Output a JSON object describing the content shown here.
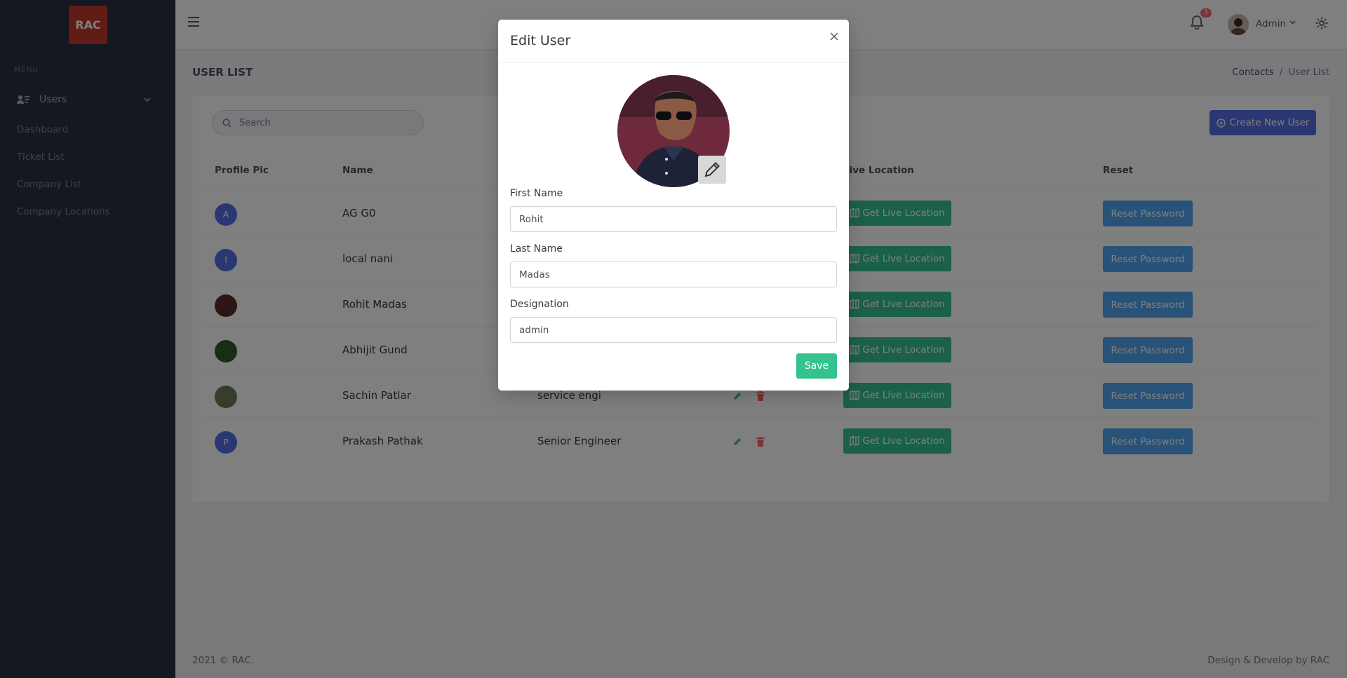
{
  "sidebar": {
    "logo": "RAC",
    "menu_title": "MENU",
    "users_label": "Users",
    "items": [
      {
        "label": "Dashboard"
      },
      {
        "label": "Ticket List"
      },
      {
        "label": "Company List"
      },
      {
        "label": "Company Locations"
      }
    ]
  },
  "header": {
    "notification_count": "3",
    "user_name": "Admin"
  },
  "page": {
    "title": "USER LIST",
    "breadcrumb": [
      "Contacts",
      "User List"
    ]
  },
  "toolbar": {
    "search_placeholder": "Search",
    "create_label": "Create New User"
  },
  "table": {
    "headers": {
      "profile": "Profile Pic",
      "name": "Name",
      "location": "Live Location",
      "reset": "Reset"
    },
    "location_label": "Get Live Location",
    "reset_label": "Reset Password",
    "rows": [
      {
        "initial": "A",
        "name": "AG G0",
        "designation": "",
        "avatar_color": "#556ee6"
      },
      {
        "initial": "l",
        "name": "local nani",
        "designation": "",
        "avatar_color": "#556ee6"
      },
      {
        "initial": "",
        "name": "Rohit Madas",
        "designation": "",
        "avatar_color": "#5a2a2a"
      },
      {
        "initial": "",
        "name": "Abhijit Gund",
        "designation": "",
        "avatar_color": "#2e5b2c"
      },
      {
        "initial": "",
        "name": "Sachin Patlar",
        "designation": "service engi",
        "avatar_color": "#6b7d55"
      },
      {
        "initial": "P",
        "name": "Prakash Pathak",
        "designation": "Senior Engineer",
        "avatar_color": "#556ee6"
      }
    ]
  },
  "footer": {
    "left": "2021 © RAC.",
    "right": "Design & Develop by RAC"
  },
  "modal": {
    "title": "Edit User",
    "first_name_label": "First Name",
    "first_name_value": "Rohit",
    "last_name_label": "Last Name",
    "last_name_value": "Madas",
    "designation_label": "Designation",
    "designation_value": "admin",
    "save_label": "Save"
  },
  "colors": {
    "sidebar_bg": "#2a3042",
    "primary": "#556ee6",
    "success": "#34c38f",
    "info": "#50a5f1",
    "danger": "#f46a6a"
  }
}
